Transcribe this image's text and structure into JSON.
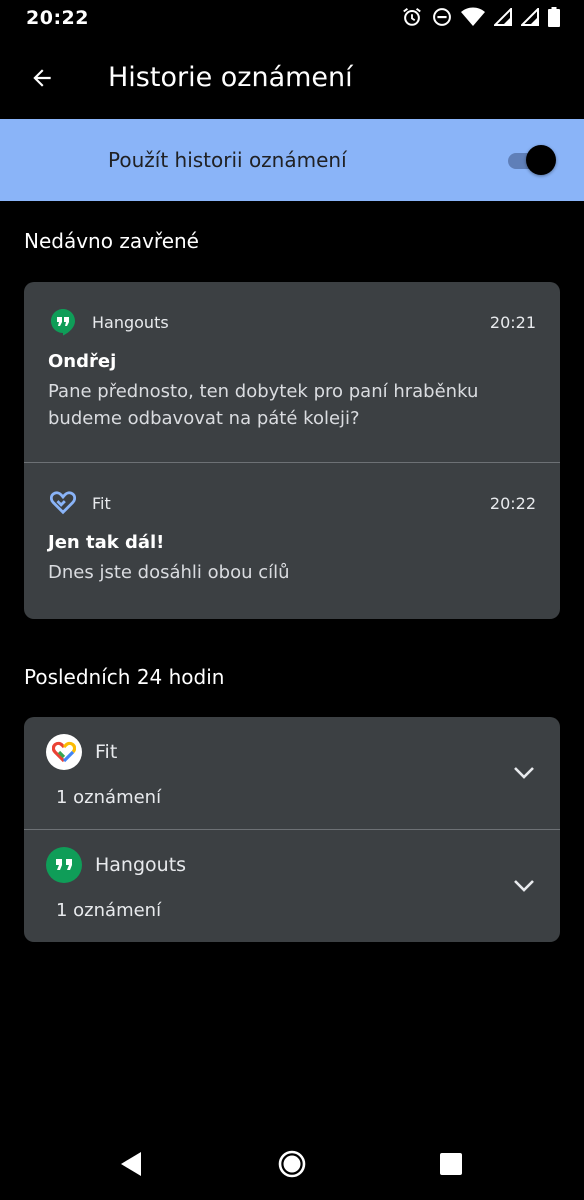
{
  "status_bar": {
    "time": "20:22",
    "icons": [
      "alarm-icon",
      "do-not-disturb-icon",
      "wifi-icon",
      "signal-icon",
      "signal-icon",
      "battery-icon"
    ]
  },
  "app_bar": {
    "title": "Historie oznámení",
    "back_icon": "arrow-back-icon"
  },
  "master_toggle": {
    "label": "Použít historii oznámení",
    "enabled": true,
    "background_color": "#8ab4f8"
  },
  "recently_dismissed": {
    "header": "Nedávno zavřené",
    "notifications": [
      {
        "app": "Hangouts",
        "icon": "hangouts-icon",
        "time": "20:21",
        "title": "Ondřej",
        "body": "Pane přednosto, ten dobytek pro paní hraběnku budeme odbavovat na páté koleji?"
      },
      {
        "app": "Fit",
        "icon": "fit-heart-icon",
        "time": "20:22",
        "title": "Jen tak dál!",
        "body": "Dnes jste dosáhli obou cílů"
      }
    ]
  },
  "last_24h": {
    "header": "Posledních 24 hodin",
    "apps": [
      {
        "name": "Fit",
        "icon": "google-fit-icon",
        "count": "1 oznámení",
        "chevron": "chevron-down-icon"
      },
      {
        "name": "Hangouts",
        "icon": "hangouts-icon",
        "count": "1 oznámení",
        "chevron": "chevron-down-icon"
      }
    ]
  },
  "nav_bar": {
    "buttons": [
      "back-triangle-icon",
      "home-circle-icon",
      "recents-square-icon"
    ]
  },
  "colors": {
    "background": "#000000",
    "card": "#3c4043",
    "accent_blue": "#8ab4f8",
    "hangouts_green": "#0f9d58"
  }
}
